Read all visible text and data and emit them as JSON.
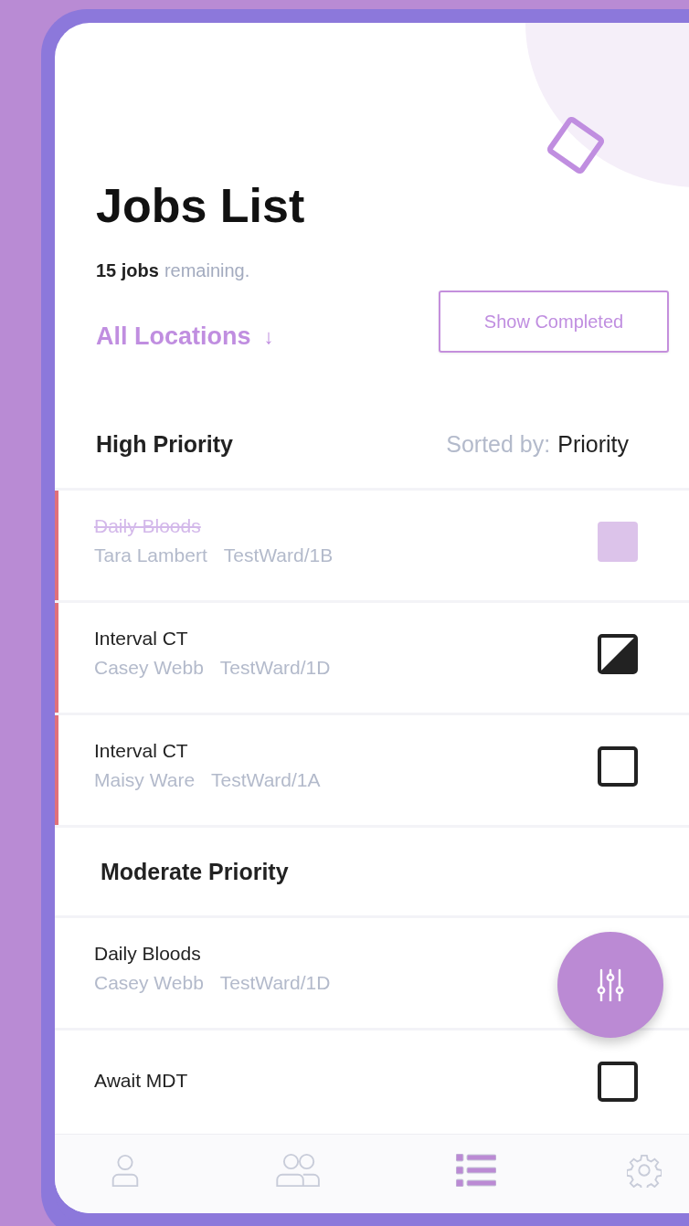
{
  "header": {
    "title": "Jobs List",
    "count": "15 jobs",
    "count_suffix": "remaining.",
    "location_filter": "All Locations",
    "location_arrow": "↓",
    "show_completed_button": "Show Completed"
  },
  "sections": [
    {
      "title": "High Priority",
      "sort_label": "Sorted by:",
      "sort_value": "Priority",
      "jobs": [
        {
          "title": "Daily Bloods",
          "patient": "Tara Lambert",
          "ward": "TestWard/1B",
          "checkbox": {
            "checked": true,
            "half": false
          },
          "flagged": true
        },
        {
          "title": "Interval CT",
          "patient": "Casey Webb",
          "ward": "TestWard/1D",
          "checkbox": {
            "checked": false,
            "half": true
          },
          "flagged": true
        },
        {
          "title": "Interval CT",
          "patient": "Maisy Ware",
          "ward": "TestWard/1A",
          "checkbox": {
            "checked": false,
            "half": false
          },
          "flagged": true
        }
      ]
    },
    {
      "title": "Moderate Priority",
      "jobs": [
        {
          "title": "Daily Bloods",
          "patient": "Casey Webb",
          "ward": "TestWard/1D",
          "flagged": false
        },
        {
          "title": "Await MDT",
          "checkbox": {
            "checked": false,
            "half": false
          },
          "flagged": false
        }
      ]
    }
  ],
  "nav": [
    {
      "kind": "person",
      "selected": false
    },
    {
      "kind": "people",
      "selected": false
    },
    {
      "kind": "list",
      "selected": true
    },
    {
      "kind": "settings",
      "selected": false
    }
  ]
}
